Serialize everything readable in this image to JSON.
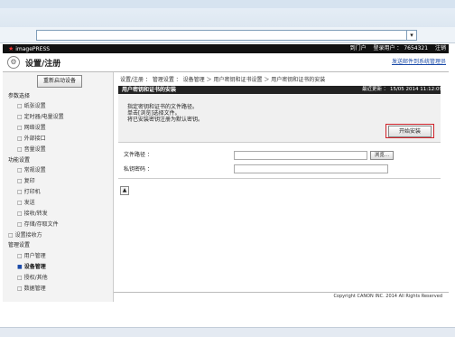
{
  "header": {
    "logo_text": "imagePRESS",
    "links": [
      "到门户",
      "登录用户 ： 7654321",
      "注销"
    ],
    "page_title": "设置/注册",
    "admin_link": "发送邮件到系统管理员"
  },
  "sidebar": {
    "reboot_button": "重新启动设备",
    "sections": [
      {
        "title": "参数选择",
        "items": [
          "纸张设置",
          "定时器/电量设置",
          "网络设置",
          "外部接口",
          "音量设置"
        ]
      },
      {
        "title": "功能设置",
        "items": [
          "常规设置",
          "复印",
          "打印机",
          "发送",
          "接收/转发",
          "存储/存取文件"
        ]
      }
    ],
    "standalone": "设置接收方",
    "management": {
      "title": "管理设置",
      "items": [
        "用户管理",
        "设备管理",
        "授权/其他",
        "数据管理"
      ],
      "active": "设备管理"
    }
  },
  "main": {
    "breadcrumb": "设置/注册 ： 管理设置 ： 设备管理 ＞ 用户密钥和证书设置 ＞ 用户密钥和证书的安装",
    "panel_title": "用户密钥和证书的安装",
    "last_update": "最近更新 ： 15/05 2014 11:12:09",
    "instructions": [
      "指定密钥和证书的文件路径。",
      "单击[浏览]选择文件。",
      "将已安装密钥注册为默认密钥。"
    ],
    "start_install_button": "开始安装",
    "file_path_label": "文件路径 ：",
    "browse_button": "浏览...",
    "private_key_label": "私钥密码 ：",
    "file_path_value": "",
    "private_key_value": "",
    "back_to_top": "▲"
  },
  "footer": {
    "copyright": "Copyright CANON INC. 2014 All Rights Reserved"
  },
  "browser": {
    "address_value": "",
    "dropdown_icon": "chevron-down-icon"
  }
}
